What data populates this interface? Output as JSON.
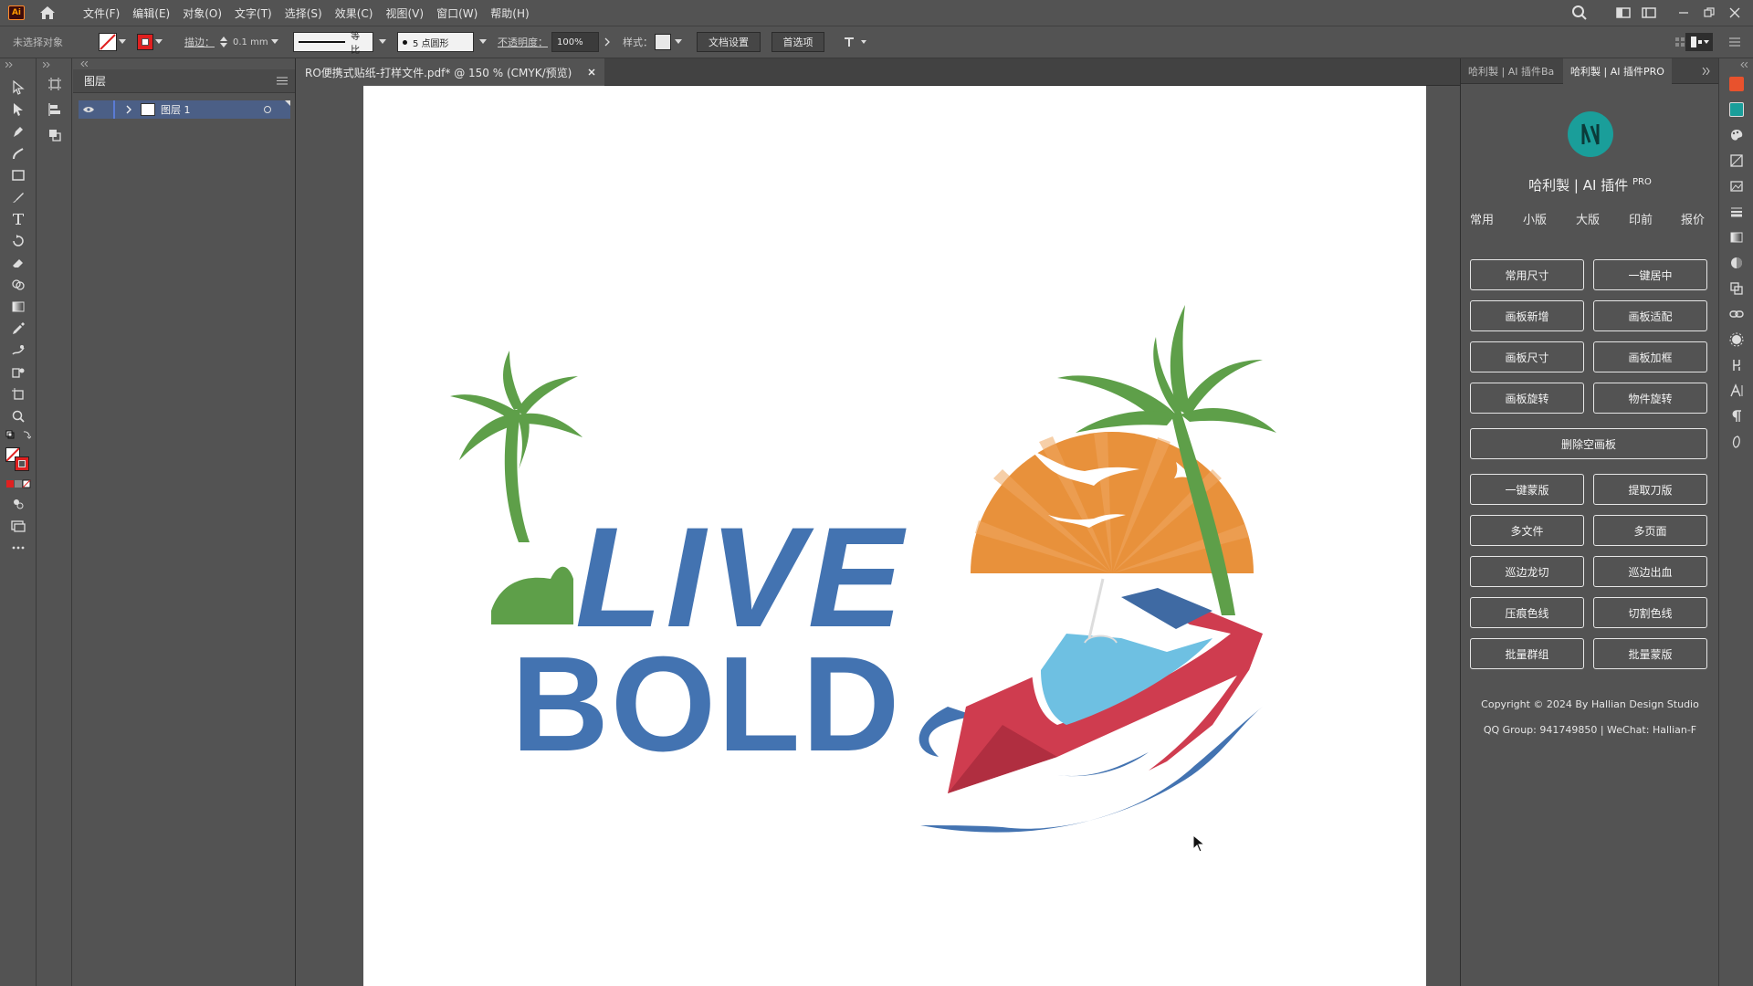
{
  "app": {
    "logo_text": "Ai"
  },
  "menu": [
    "文件(F)",
    "编辑(E)",
    "对象(O)",
    "文字(T)",
    "选择(S)",
    "效果(C)",
    "视图(V)",
    "窗口(W)",
    "帮助(H)"
  ],
  "control_bar": {
    "selection_status": "未选择对象",
    "stroke_label": "描边：",
    "stroke_value": "0.1 mm",
    "stroke_profile": "等比",
    "brush_value": "5 点圆形",
    "opacity_label": "不透明度：",
    "opacity_value": "100%",
    "style_label": "样式：",
    "doc_setup_button": "文档设置",
    "preferences_button": "首选项"
  },
  "layers_panel": {
    "tab": "图层",
    "layer_name": "图层 1"
  },
  "document": {
    "tab_title": "RO便携式贴纸-打样文件.pdf* @ 150 % (CMYK/预览)"
  },
  "artwork": {
    "line1": "LIVE",
    "line2": "BOLD"
  },
  "plugin_panel": {
    "tab_inactive": "哈利製 | AI 插件Ba",
    "tab_active": "哈利製 | AI 插件PRO",
    "brand_title": "哈利製 | AI 插件",
    "brand_sup": "PRO",
    "nav": [
      "常用",
      "小版",
      "大版",
      "印前",
      "报价"
    ],
    "buttons_row1": [
      "常用尺寸",
      "一键居中"
    ],
    "buttons_row2": [
      "画板新增",
      "画板适配"
    ],
    "buttons_row3": [
      "画板尺寸",
      "画板加框"
    ],
    "buttons_row4": [
      "画板旋转",
      "物件旋转"
    ],
    "button_wide": "删除空画板",
    "buttons_row5": [
      "一键蒙版",
      "提取刀版"
    ],
    "buttons_row6": [
      "多文件",
      "多页面"
    ],
    "buttons_row7": [
      "巡边龙切",
      "巡边出血"
    ],
    "buttons_row8": [
      "压痕色线",
      "切割色线"
    ],
    "buttons_row9": [
      "批量群组",
      "批量蒙版"
    ],
    "copyright": "Copyright © 2024 By Hallian Design Studio",
    "contact": "QQ Group: 941749850 | WeChat: Hallian-F"
  },
  "colors": {
    "ui_bg": "#535353",
    "accent_teal": "#1a9e9a",
    "logo_blue": "#4373b1",
    "logo_green": "#5e9f49",
    "logo_orange": "#e8913b",
    "boat_red": "#cf3c4f",
    "boat_window": "#6ec0e2"
  }
}
